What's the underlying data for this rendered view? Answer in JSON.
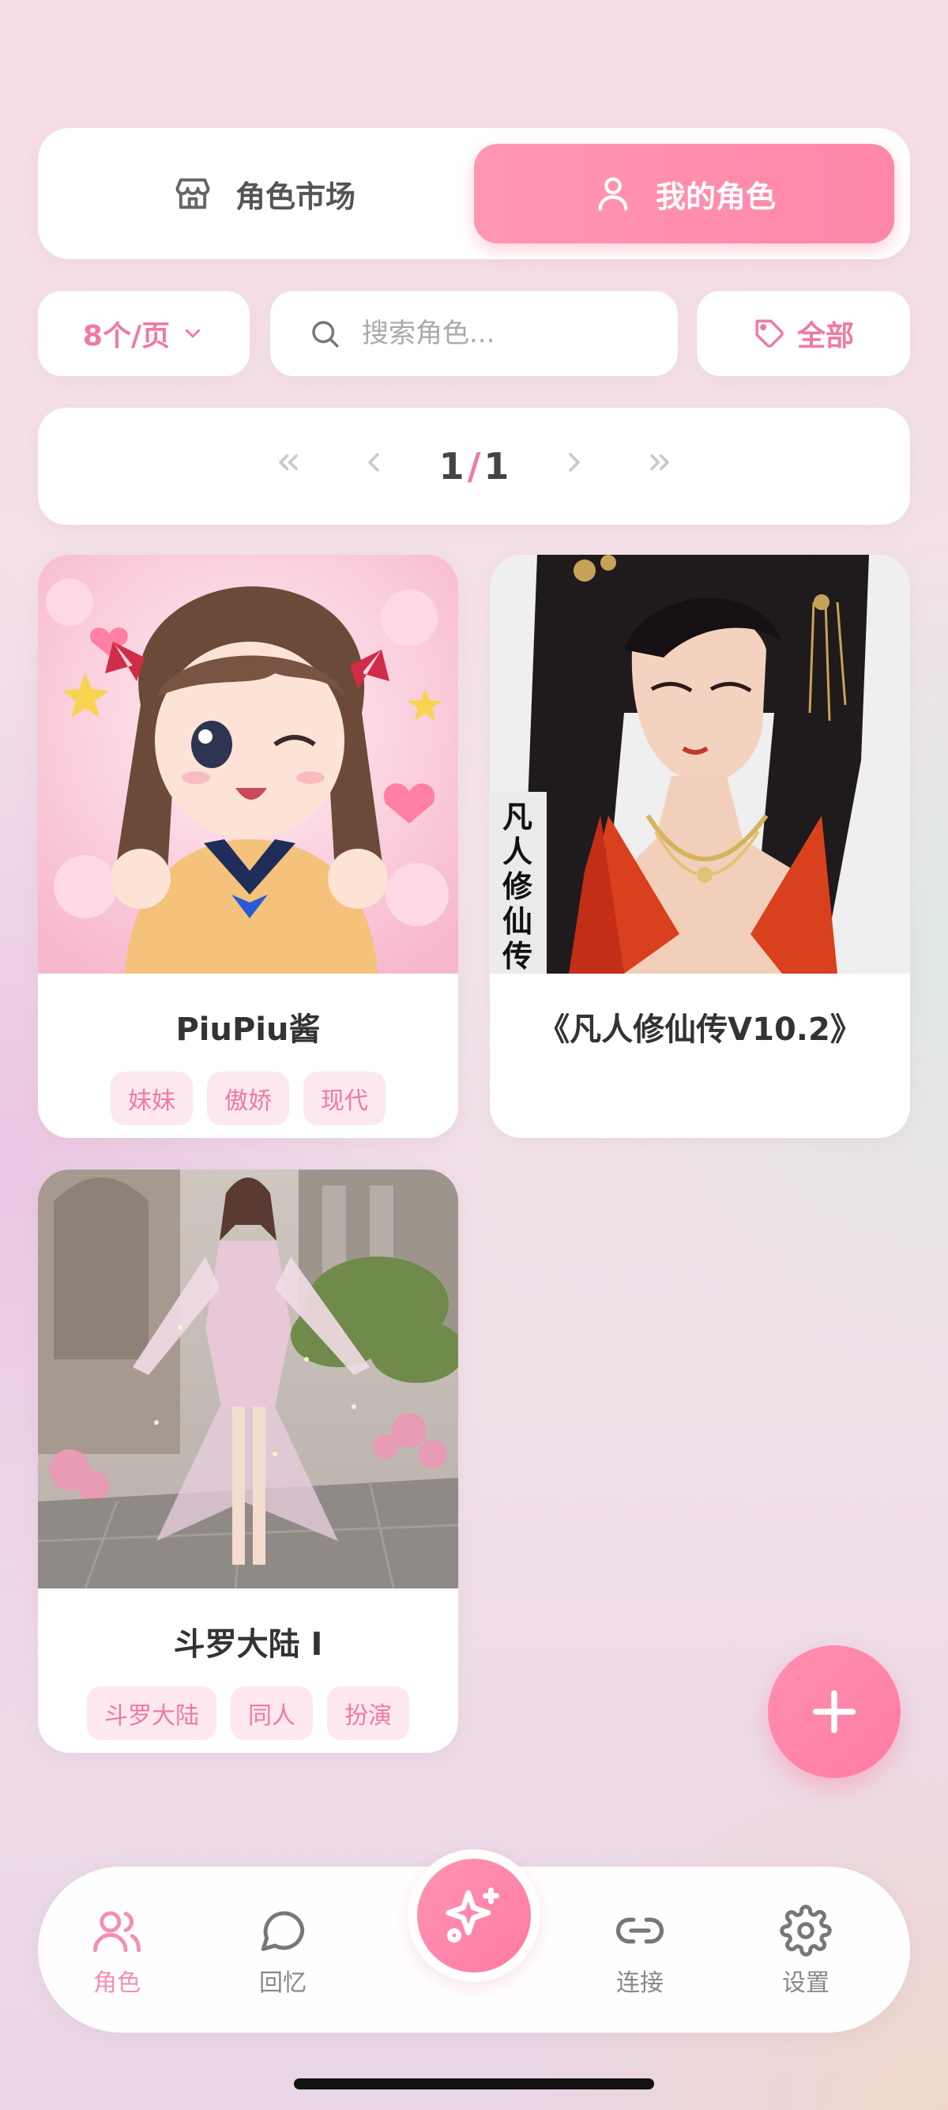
{
  "tabs": [
    {
      "label": "角色市场",
      "icon": "store-icon",
      "active": false
    },
    {
      "label": "我的角色",
      "icon": "user-icon",
      "active": true
    }
  ],
  "filters": {
    "per_page": "8个/页",
    "search_placeholder": "搜索角色...",
    "tag_filter": "全部"
  },
  "pagination": {
    "current": "1",
    "separator": "/",
    "total": "1"
  },
  "characters": [
    {
      "name": "PiuPiu酱",
      "tags": [
        "妹妹",
        "傲娇",
        "现代"
      ]
    },
    {
      "name": "《凡人修仙传V10.2》",
      "tags": [],
      "image_text": "凡人修仙传"
    },
    {
      "name": "斗罗大陆 I",
      "tags": [
        "斗罗大陆",
        "同人",
        "扮演"
      ]
    }
  ],
  "bottom_nav": [
    {
      "label": "角色",
      "icon": "users-icon",
      "active": true
    },
    {
      "label": "回忆",
      "icon": "chat-bubble-icon",
      "active": false
    },
    {
      "label": "连接",
      "icon": "link-icon",
      "active": false
    },
    {
      "label": "设置",
      "icon": "gear-icon",
      "active": false
    }
  ],
  "colors": {
    "accent": "#ff8aab",
    "accent_text": "#f07aa0",
    "tag_bg": "#fde8ef"
  }
}
